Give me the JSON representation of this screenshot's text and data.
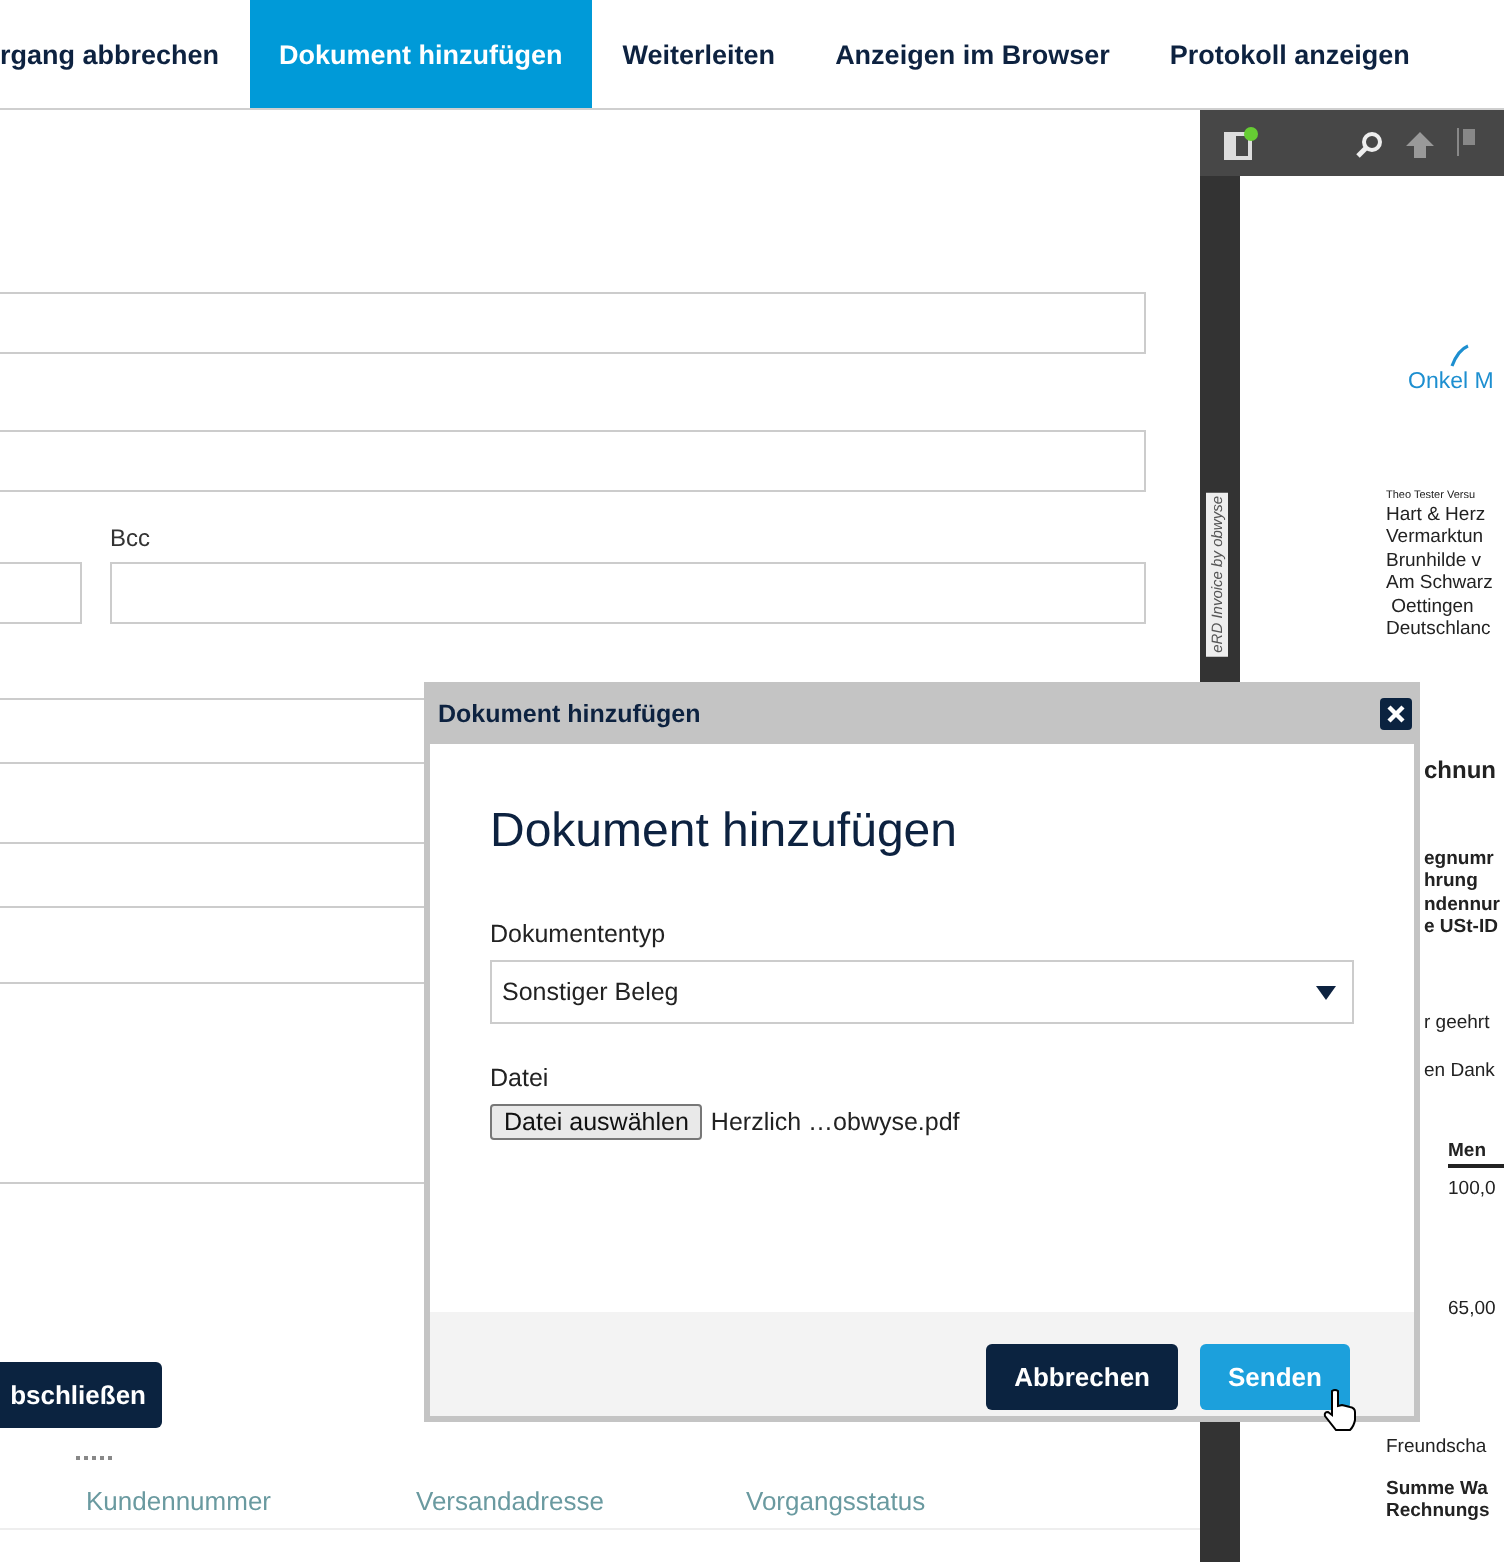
{
  "tabs": [
    {
      "label": "rgang abbrechen",
      "selected": false
    },
    {
      "label": "Dokument hinzufügen",
      "selected": true
    },
    {
      "label": "Weiterleiten",
      "selected": false
    },
    {
      "label": "Anzeigen im Browser",
      "selected": false
    },
    {
      "label": "Protokoll anzeigen",
      "selected": false
    }
  ],
  "form": {
    "bcc_label": "Bcc",
    "finish_button": "bschließen"
  },
  "table": {
    "columns": [
      "Kundennummer",
      "Versandadresse",
      "Vorgangsstatus"
    ]
  },
  "pdf_viewer": {
    "side_tag": "eRD Invoice by obwyse",
    "logo_text": "Onkel M",
    "sender_line": "Theo Tester Versu",
    "address_lines": [
      "Hart & Herz",
      "Vermarktun",
      "Brunhilde v",
      "Am Schwarz",
      " Oettingen",
      "Deutschlanc"
    ],
    "heading": "chnun",
    "meta_lines": [
      "egnumr",
      "hrung",
      "ndennur",
      "e USt-ID"
    ],
    "greeting": "r geehrt",
    "thanks": "en Dank",
    "column_header": "Men",
    "amounts": [
      "100,0",
      "65,00"
    ],
    "closing": "Freundscha",
    "summary_lines": [
      "Summe Wa",
      "Rechnungs"
    ]
  },
  "dialog": {
    "title": "Dokument hinzufügen",
    "heading": "Dokument hinzufügen",
    "type_label": "Dokumententyp",
    "type_value": "Sonstiger Beleg",
    "file_label": "Datei",
    "file_button": "Datei auswählen",
    "file_name": "Herzlich …obwyse.pdf",
    "cancel_button": "Abbrechen",
    "send_button": "Senden"
  }
}
